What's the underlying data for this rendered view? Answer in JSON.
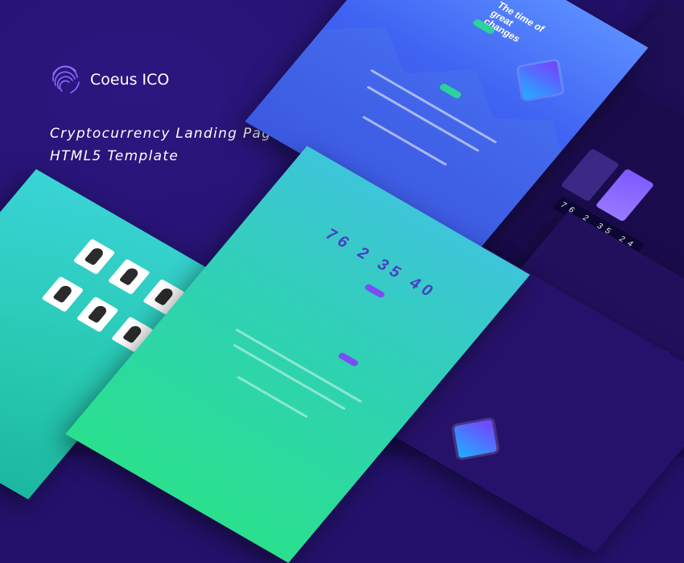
{
  "brand": {
    "name": "Coeus ICO",
    "logo_icon": "fingerprint-icon"
  },
  "tagline": {
    "line1": "Cryptocurrency Landing Page",
    "line2": "HTML5 Template"
  },
  "mockups": {
    "blue_hero_title": "The time of great changes",
    "countdown": "76  2  35  40",
    "dark_timer": "76  2  35  24"
  },
  "colors": {
    "background": "#23126b",
    "accent_green": "#2bd39b",
    "accent_purple": "#7b4df2",
    "text": "#ffffff"
  }
}
